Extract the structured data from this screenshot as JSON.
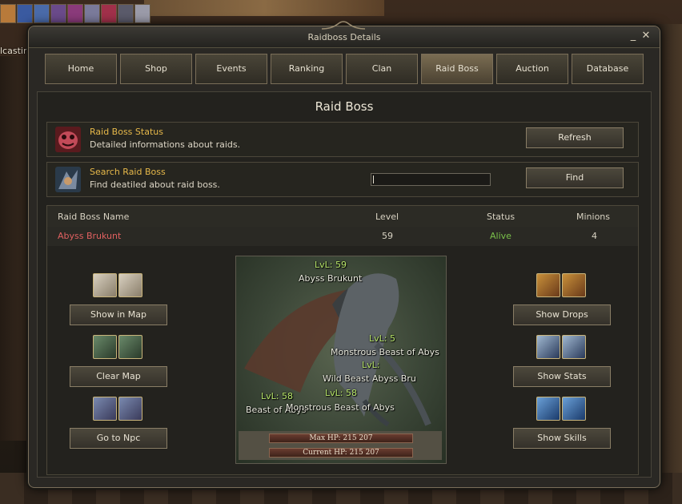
{
  "background": {
    "text_fragment": "lcastin  Tower"
  },
  "window": {
    "title": "Raidboss Details",
    "minimize_glyph": "_",
    "close_glyph": "✕"
  },
  "tabs": [
    {
      "label": "Home"
    },
    {
      "label": "Shop"
    },
    {
      "label": "Events"
    },
    {
      "label": "Ranking"
    },
    {
      "label": "Clan"
    },
    {
      "label": "Raid Boss",
      "active": true
    },
    {
      "label": "Auction"
    },
    {
      "label": "Database"
    }
  ],
  "panel_title": "Raid Boss",
  "status_card": {
    "title": "Raid Boss Status",
    "subtitle": "Detailed informations about raids.",
    "button": "Refresh",
    "icon": "raid-status-icon"
  },
  "search_card": {
    "title": "Search Raid Boss",
    "subtitle": "Find deatiled about raid boss.",
    "button": "Find",
    "input_value": "",
    "icon": "raid-search-icon"
  },
  "table": {
    "headers": [
      "Raid Boss Name",
      "Level",
      "Status",
      "Minions"
    ],
    "rows": [
      {
        "name": "Abyss Brukunt",
        "level": "59",
        "status": "Alive",
        "minions": "4"
      }
    ]
  },
  "left_actions": [
    {
      "label": "Show in Map",
      "icon": "map-scroll-icon"
    },
    {
      "label": "Clear Map",
      "icon": "character-icon"
    },
    {
      "label": "Go to Npc",
      "icon": "teleport-hand-icon"
    }
  ],
  "right_actions": [
    {
      "label": "Show Drops",
      "icon": "treasure-chest-icon"
    },
    {
      "label": "Show Stats",
      "icon": "portrait-icon"
    },
    {
      "label": "Show Skills",
      "icon": "skill-hand-icon"
    }
  ],
  "preview": {
    "labels": [
      {
        "text": "LvL: 59",
        "level": true
      },
      {
        "text": "Abyss Brukunt"
      },
      {
        "text": "LvL: 5",
        "level": true
      },
      {
        "text": "Monstrous Beast of Abys"
      },
      {
        "text": "LvL:",
        "level": true
      },
      {
        "text": "Wild Beast  Abyss Bru"
      },
      {
        "text": "LvL: 58",
        "level": true
      },
      {
        "text": "LvL: 58",
        "level": true
      },
      {
        "text": "Beast of Abys"
      },
      {
        "text": "Monstrous Beast of Abys"
      }
    ],
    "max_hp": "Max HP: 215 207",
    "current_hp": "Current HP: 215 207"
  },
  "colors": {
    "accent_gold": "#e6b84a",
    "boss_name": "#e06060",
    "status_alive": "#7ac04a",
    "level_green": "#b8e66a"
  }
}
